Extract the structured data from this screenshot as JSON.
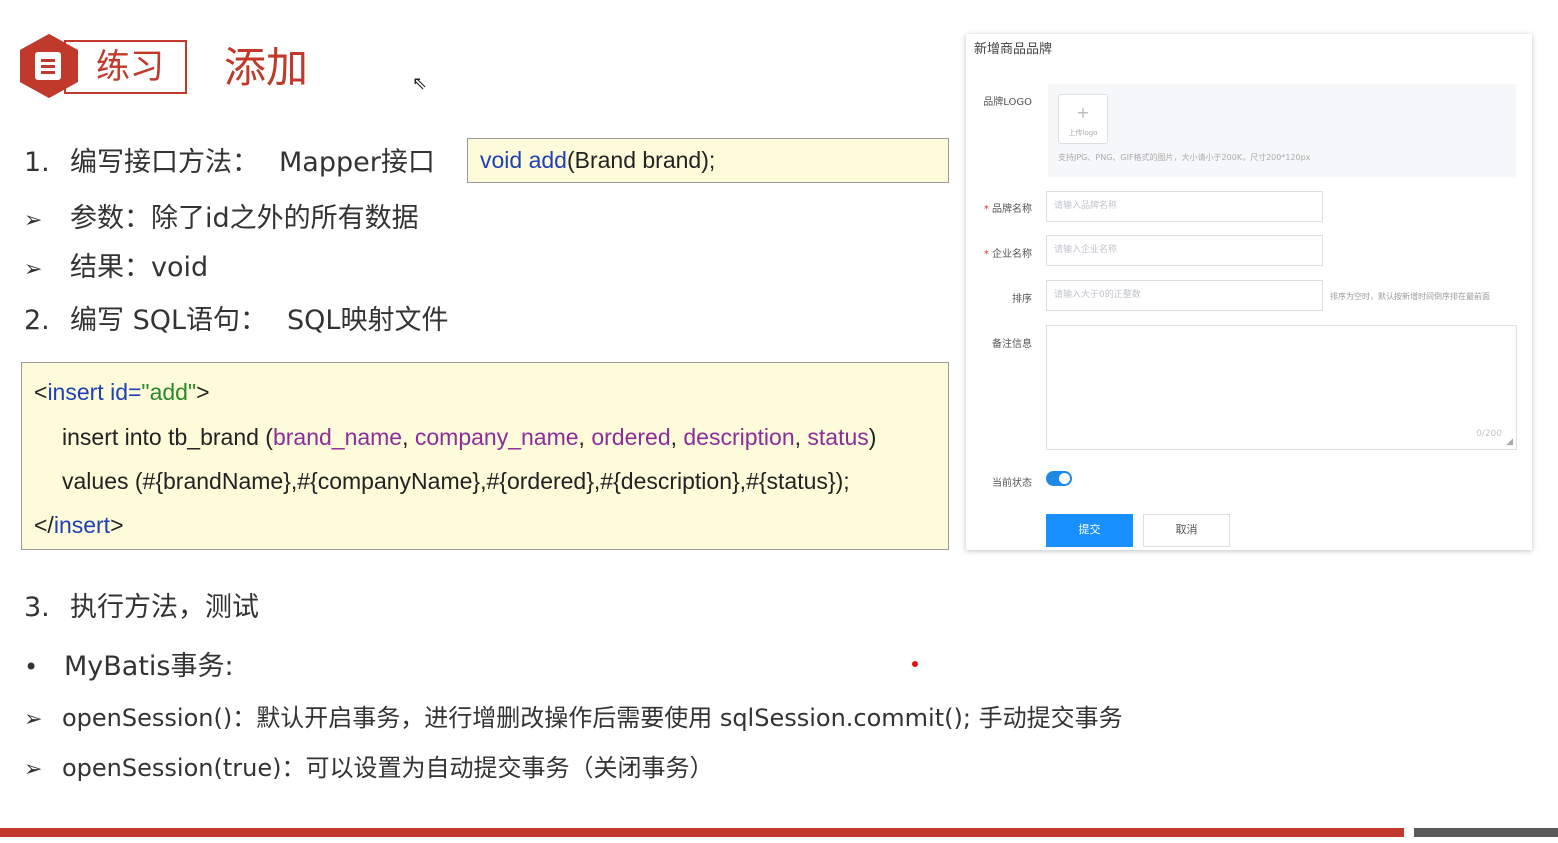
{
  "header": {
    "badge": "练习",
    "title": "添加"
  },
  "step1": {
    "num": "1.",
    "label": "编写接口方法：",
    "target": "Mapper接口",
    "code": {
      "ret": "void",
      "method": "add",
      "params": "(Brand brand);"
    },
    "params_label": "参数：除了id之外的所有数据",
    "result_label": "结果：void"
  },
  "step2": {
    "num": "2.",
    "label": "编写 SQL语句：",
    "target": "SQL映射文件"
  },
  "sql": {
    "open_lt": "<",
    "tag": "insert",
    "id_attr": " id=",
    "id_value": "\"add\"",
    "open_gt": ">",
    "l2_prefix": "insert into tb_brand (",
    "cols": [
      "brand_name",
      "company_name",
      "ordered",
      "description",
      "status"
    ],
    "sep": ", ",
    "l2_suffix": ")",
    "l3": "values (#{brandName},#{companyName},#{ordered},#{description},#{status});",
    "close_lt": "</",
    "close_gt": ">"
  },
  "step3": {
    "num": "3.",
    "label": "执行方法，测试"
  },
  "transaction": {
    "title": "MyBatis事务:",
    "item1": "openSession()：默认开启事务，进行增删改操作后需要使用 sqlSession.commit(); 手动提交事务",
    "item2": "openSession(true)：可以设置为自动提交事务（关闭事务）"
  },
  "form": {
    "title": "新增商品品牌",
    "logo_label": "品牌LOGO",
    "upload_caption": "上传logo",
    "upload_hint": "支持JPG、PNG、GIF格式的图片，大小请小于200K，尺寸200*120px",
    "brand_name_label": "品牌名称",
    "brand_name_placeholder": "请输入品牌名称",
    "company_label": "企业名称",
    "company_placeholder": "请输入企业名称",
    "sort_label": "排序",
    "sort_placeholder": "请输入大于0的正整数",
    "sort_hint": "排序为空时，默认按新增时间倒序排在最前面",
    "remark_label": "备注信息",
    "remark_count": "0/200",
    "status_label": "当前状态",
    "status_on": true,
    "submit": "提交",
    "cancel": "取消"
  },
  "colors": {
    "accent": "#c0392b",
    "primary": "#1890ff",
    "code_bg": "#fdfbd9"
  }
}
